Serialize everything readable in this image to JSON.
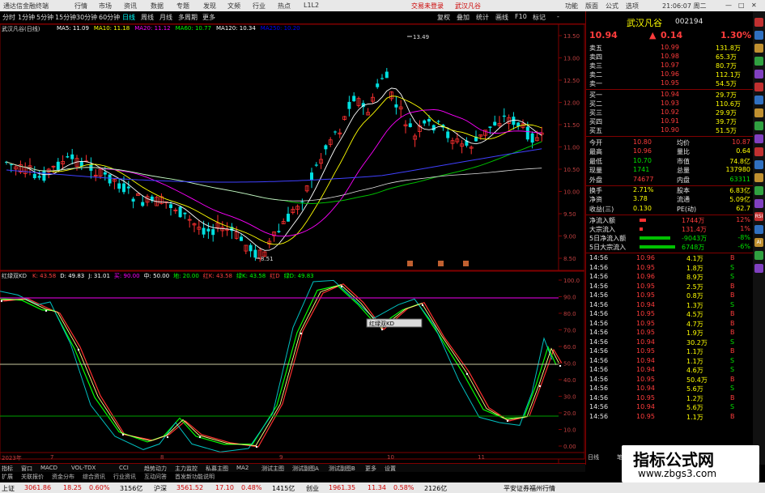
{
  "titlebar": {
    "app_name": "通达信金融终端",
    "menus": [
      "行情",
      "市场",
      "资讯",
      "数据",
      "专题",
      "发现",
      "文频",
      "行业",
      "热点",
      "L1L2"
    ],
    "trade_login": "交易未登录",
    "stock_name": "武汉凡谷",
    "right_menus": [
      "功能",
      "版面",
      "公式",
      "选项"
    ],
    "clock": "21:06:07 周二"
  },
  "toolbar": {
    "periods": [
      "分时",
      "1分钟",
      "5分钟",
      "15分钟",
      "30分钟",
      "60分钟",
      "日线",
      "周线",
      "月线",
      "多周期",
      "更多"
    ],
    "active": "日线",
    "right_items": [
      "复权",
      "叠加",
      "统计",
      "画线",
      "F10",
      "标记",
      "-"
    ]
  },
  "main_chart": {
    "title": "武汉凡谷(日线)",
    "ma_labels": [
      {
        "text": "MA5: 11.09",
        "color": "#ffffff"
      },
      {
        "text": "MA10: 11.18",
        "color": "#ffff00"
      },
      {
        "text": "MA20: 11.12",
        "color": "#ff00ff"
      },
      {
        "text": "MA60: 10.77",
        "color": "#00ff00"
      },
      {
        "text": "MA120: 10.34",
        "color": "#ffffff"
      },
      {
        "text": "MA250: 10.20",
        "color": "#0000ff"
      }
    ],
    "high_label": "13.49",
    "low_label": "8.51",
    "price_ticks": [
      "13.50",
      "13.00",
      "12.50",
      "12.00",
      "11.50",
      "11.00",
      "10.50",
      "10.00",
      "9.50",
      "9.00",
      "8.50"
    ]
  },
  "kd_panel": {
    "title": "红绿双KD",
    "labels": [
      {
        "text": "K: 43.58",
        "color": "#ff4040"
      },
      {
        "text": "D: 49.83",
        "color": "#ffffff"
      },
      {
        "text": "J: 31.01",
        "color": "#ffffff"
      },
      {
        "text": "买: 90.00",
        "color": "#ff00ff"
      },
      {
        "text": "中: 50.00",
        "color": "#ffffff"
      },
      {
        "text": "地: 20.00",
        "color": "#00ff00"
      },
      {
        "text": "红K: 43.58",
        "color": "#ff4040"
      },
      {
        "text": "绿K: 43.58",
        "color": "#00ff00"
      },
      {
        "text": "红D",
        "color": "#ff4040"
      },
      {
        "text": "绿D: 49.83",
        "color": "#00ff00"
      }
    ],
    "ticks": [
      "100.0",
      "90.0",
      "80.0",
      "70.0",
      "60.0",
      "50.0",
      "40.0",
      "30.0",
      "20.0",
      "10.0",
      "0.00"
    ],
    "tooltip": "红绿双KD"
  },
  "date_axis": [
    "2023年",
    "7",
    "8",
    "9",
    "10",
    "11"
  ],
  "bottom_tabs": [
    "指标",
    "窗口",
    "MACD",
    "VOL-TDX",
    "CCI",
    "趋势动力",
    "主力监控",
    "私募主图",
    "MA2",
    "测试主图",
    "测试副图A",
    "测试副图B",
    "更多",
    "设置"
  ],
  "bottom_tabs2": [
    "扩展",
    "关联报价",
    "资金分布",
    "综合资讯",
    "行业资讯",
    "互动问答",
    "首发新功能说明"
  ],
  "quote": {
    "name": "武汉凡谷",
    "code": "002194",
    "price": "10.94",
    "change": "0.14",
    "pct": "1.30%",
    "asks": [
      {
        "label": "卖五",
        "price": "10.99",
        "vol": "131.8万"
      },
      {
        "label": "卖四",
        "price": "10.98",
        "vol": "65.3万"
      },
      {
        "label": "卖三",
        "price": "10.97",
        "vol": "80.7万"
      },
      {
        "label": "卖二",
        "price": "10.96",
        "vol": "112.1万"
      },
      {
        "label": "卖一",
        "price": "10.95",
        "vol": "54.5万"
      }
    ],
    "bids": [
      {
        "label": "买一",
        "price": "10.94",
        "vol": "29.7万"
      },
      {
        "label": "买二",
        "price": "10.93",
        "vol": "110.6万"
      },
      {
        "label": "买三",
        "price": "10.92",
        "vol": "29.9万"
      },
      {
        "label": "买四",
        "price": "10.91",
        "vol": "39.7万"
      },
      {
        "label": "买五",
        "price": "10.90",
        "vol": "51.5万"
      }
    ],
    "stats": [
      {
        "l1": "今开",
        "v1": "10.80",
        "l2": "均价",
        "v2": "10.87"
      },
      {
        "l1": "最高",
        "v1": "10.96",
        "l2": "量比",
        "v2": "0.64"
      },
      {
        "l1": "最低",
        "v1": "10.70",
        "l2": "市值",
        "v2": "74.8亿"
      },
      {
        "l1": "现量",
        "v1": "1741",
        "l2": "总量",
        "v2": "137980"
      },
      {
        "l1": "外盘",
        "v1": "74677",
        "l2": "内盘",
        "v2": "63311"
      },
      {
        "l1": "换手",
        "v1": "2.71%",
        "l2": "股本",
        "v2": "6.83亿"
      },
      {
        "l1": "净资",
        "v1": "3.78",
        "l2": "流通",
        "v2": "5.09亿"
      },
      {
        "l1": "收益(三)",
        "v1": "0.130",
        "l2": "PE(动)",
        "v2": "62.7"
      }
    ],
    "flows": [
      {
        "label": "净流入额",
        "value": "1744万",
        "pct": "12%"
      },
      {
        "label": "大宗流入",
        "value": "131.4万",
        "pct": "1%"
      },
      {
        "label": "5日净流入额",
        "value": "-9043万",
        "pct": "-8%"
      },
      {
        "label": "5日大宗流入",
        "value": "6748万",
        "pct": "-6%"
      }
    ],
    "ticks": [
      {
        "t": "14:56",
        "p": "10.96",
        "v": "4.1万",
        "d": "B"
      },
      {
        "t": "14:56",
        "p": "10.95",
        "v": "1.8万",
        "d": "S"
      },
      {
        "t": "14:56",
        "p": "10.96",
        "v": "8.9万",
        "d": "S"
      },
      {
        "t": "14:56",
        "p": "10.95",
        "v": "2.5万",
        "d": "B"
      },
      {
        "t": "14:56",
        "p": "10.95",
        "v": "0.8万",
        "d": "B"
      },
      {
        "t": "14:56",
        "p": "10.94",
        "v": "1.3万",
        "d": "S"
      },
      {
        "t": "14:56",
        "p": "10.95",
        "v": "4.5万",
        "d": "B"
      },
      {
        "t": "14:56",
        "p": "10.95",
        "v": "4.7万",
        "d": "B"
      },
      {
        "t": "14:56",
        "p": "10.95",
        "v": "1.9万",
        "d": "B"
      },
      {
        "t": "14:56",
        "p": "10.94",
        "v": "30.2万",
        "d": "S"
      },
      {
        "t": "14:56",
        "p": "10.95",
        "v": "1.1万",
        "d": "B"
      },
      {
        "t": "14:56",
        "p": "10.94",
        "v": "1.1万",
        "d": "S"
      },
      {
        "t": "14:56",
        "p": "10.94",
        "v": "4.6万",
        "d": "S"
      },
      {
        "t": "14:56",
        "p": "10.95",
        "v": "50.4万",
        "d": "B"
      },
      {
        "t": "14:56",
        "p": "10.94",
        "v": "5.6万",
        "d": "S"
      },
      {
        "t": "14:56",
        "p": "10.95",
        "v": "1.2万",
        "d": "B"
      },
      {
        "t": "14:56",
        "p": "10.94",
        "v": "5.6万",
        "d": "S"
      },
      {
        "t": "14:56",
        "p": "10.95",
        "v": "1.1万",
        "d": "B"
      }
    ],
    "bottom_tabs": [
      "日线",
      "笔",
      "分",
      "价",
      "细",
      "势",
      "指",
      "联",
      "值",
      "主"
    ]
  },
  "status": {
    "items": [
      {
        "name": "上证",
        "val": "3061.86",
        "chg": "18.25",
        "pct": "0.60%",
        "amt": "3156亿"
      },
      {
        "name": "沪深",
        "val": "3561.52",
        "chg": "17.10",
        "pct": "0.48%",
        "amt": "1415亿"
      },
      {
        "name": "创业",
        "val": "1961.35",
        "chg": "11.34",
        "pct": "0.58%",
        "amt": "2126亿"
      }
    ],
    "broker": "平安证券福州行情"
  },
  "watermark": {
    "line1": "指标公式网",
    "line2": "www.zbgs3.com"
  },
  "sidebar_icons": [
    "RSI",
    "AI"
  ]
}
